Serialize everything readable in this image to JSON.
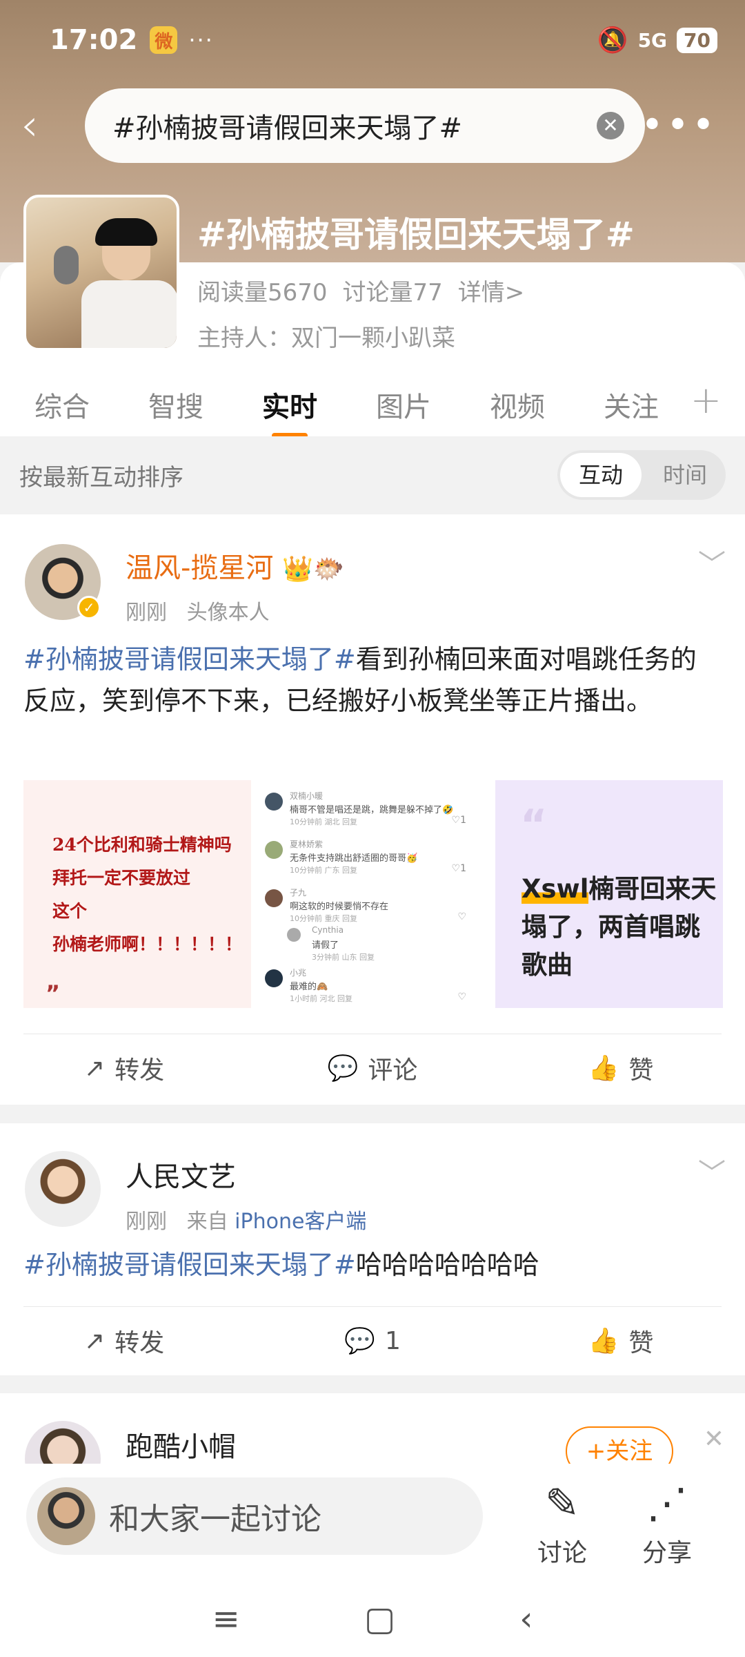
{
  "status_bar": {
    "time": "17:02",
    "weibo_icon": "weibo-logo",
    "dots": "···",
    "mute_icon": "🔕",
    "signal": "5G",
    "battery": "70"
  },
  "search": {
    "query": "#孙楠披哥请假回来天塌了#"
  },
  "topic": {
    "title": "#孙楠披哥请假回来天塌了#",
    "read": "阅读量5670",
    "discuss": "讨论量77",
    "details": "详情>",
    "host": "主持人：双门一颗小趴菜"
  },
  "tabs": [
    {
      "label": "综合"
    },
    {
      "label": "智搜"
    },
    {
      "label": "实时"
    },
    {
      "label": "图片"
    },
    {
      "label": "视频"
    },
    {
      "label": "关注"
    }
  ],
  "sort": {
    "label": "按最新互动排序",
    "options": [
      "互动",
      "时间"
    ],
    "selected": "互动"
  },
  "posts": [
    {
      "user": "温风-揽星河",
      "time": "刚刚",
      "source": "头像本人",
      "hashtag": "#孙楠披哥请假回来天塌了#",
      "text": "看到孙楠回来面对唱跳任务的反应，笑到停不下来，已经搬好小板凳坐等正片播出。",
      "image1_text": "24个比利和骑士精神吗\n拜托一定不要放过\n这个\n孙楠老师啊！！！！！！",
      "image1_mark": "”",
      "image2_comments": [
        {
          "name": "双楠小暖",
          "comment": "楠哥不管是唱还是跳，跳舞是躲不掉了🤣",
          "meta": "10分钟前  湖北  回复",
          "likes": "♡1"
        },
        {
          "name": "夏林娇紫",
          "comment": "无条件支持跳出舒适圈的哥哥🥳",
          "meta": "10分钟前  广东  回复",
          "likes": "♡1"
        },
        {
          "name": "子九",
          "comment": "啊这软的时候要悄不存在",
          "meta": "10分钟前  重庆  回复",
          "likes": "♡"
        },
        {
          "name": "小兆",
          "comment": "最难的🙈",
          "meta": "1小时前  河北  回复",
          "likes": "♡"
        }
      ],
      "image2_reply": {
        "name": "Cynthia",
        "comment": "请假了",
        "meta": "3分钟前  山东  回复"
      },
      "image3_quote": "“",
      "image3_highlight": "Xswl",
      "image3_text": "楠哥回来天塌了，两首唱跳歌曲",
      "repost": "转发",
      "comment": "评论",
      "like": "赞"
    },
    {
      "user": "人民文艺",
      "time": "刚刚",
      "source_prefix": "来自",
      "source": "iPhone客户端",
      "hashtag": "#孙楠披哥请假回来天塌了#",
      "text": "哈哈哈哈哈哈哈",
      "repost": "转发",
      "comment": "1",
      "like": "赞"
    },
    {
      "user": "跑酷小帽",
      "follow": "+关注"
    }
  ],
  "bottom": {
    "placeholder": "和大家一起讨论",
    "discuss": "讨论",
    "share": "分享"
  },
  "colors": {
    "accent": "#ff8200",
    "hashtag": "#4a70ae",
    "username_vip": "#e86c12"
  }
}
